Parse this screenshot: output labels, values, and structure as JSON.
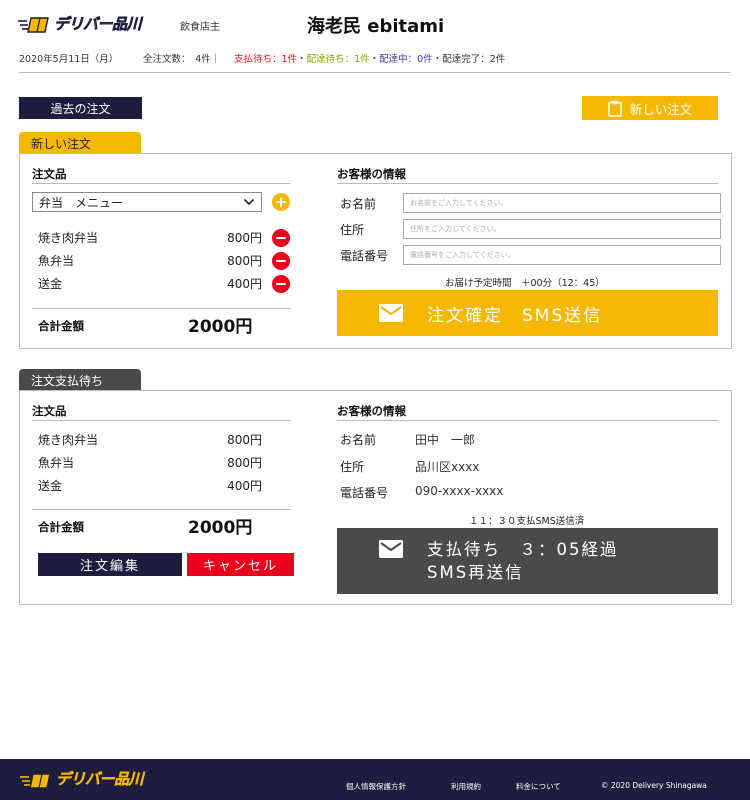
{
  "header": {
    "logo_text": "デリバー品川",
    "role": "飲食店主",
    "shop_name": "海老民 ebitami",
    "date": "2020年5月11日（月）",
    "total_orders": "全注文数：　4件｜",
    "pending_payment": "支払待ち：1件",
    "pending_delivery": "配達待ち：1件",
    "in_delivery": "配達中：0件",
    "delivered": "配達完了：2件",
    "separator": "・"
  },
  "toolbar": {
    "past_orders_label": "過去の注文",
    "new_order_label": "新しい注文"
  },
  "new_order": {
    "tab_label": "新しい注文",
    "items_title": "注文品",
    "menu_select_value": "弁当　メニュー",
    "items": [
      {
        "name": "焼き肉弁当",
        "price": "800円"
      },
      {
        "name": "魚弁当",
        "price": "800円"
      },
      {
        "name": "送金",
        "price": "400円"
      }
    ],
    "total_label": "合計金額",
    "total_value": "2000円",
    "customer_title": "お客様の情報",
    "name_label": "お名前",
    "name_placeholder": "お名前をご入力してください。",
    "address_label": "住所",
    "address_placeholder": "住所をご入力してください。",
    "phone_label": "電話番号",
    "phone_placeholder": "電話番号をご入力してください。",
    "delivery_time": "お届け予定時間　＋00分（12：45）",
    "confirm_label": "注文確定　SMS送信"
  },
  "pending_order": {
    "tab_label": "注文支払待ち",
    "items_title": "注文品",
    "items": [
      {
        "name": "焼き肉弁当",
        "price": "800円"
      },
      {
        "name": "魚弁当",
        "price": "800円"
      },
      {
        "name": "送金",
        "price": "400円"
      }
    ],
    "total_label": "合計金額",
    "total_value": "2000円",
    "edit_label": "注文編集",
    "cancel_label": "キャンセル",
    "customer_title": "お客様の情報",
    "name_label": "お名前",
    "name_value": "田中　一郎",
    "address_label": "住所",
    "address_value": "品川区xxxx",
    "phone_label": "電話番号",
    "phone_value": "090-xxxx-xxxx",
    "sms_note": "１１：３０支払SMS送信済",
    "resend_line1": "支払待ち　３：05経過",
    "resend_line2": "SMS再送信"
  },
  "footer": {
    "logo_text": "デリバー品川",
    "privacy": "個人情報保護方針",
    "terms": "利用規約",
    "pricing": "料金について",
    "copyright": "© 2020 Delivery Shinagawa"
  },
  "colors": {
    "navy": "#1f1d3d",
    "yellow": "#f5b800",
    "red": "#e8001c",
    "dark_gray": "#4a4a4a"
  }
}
